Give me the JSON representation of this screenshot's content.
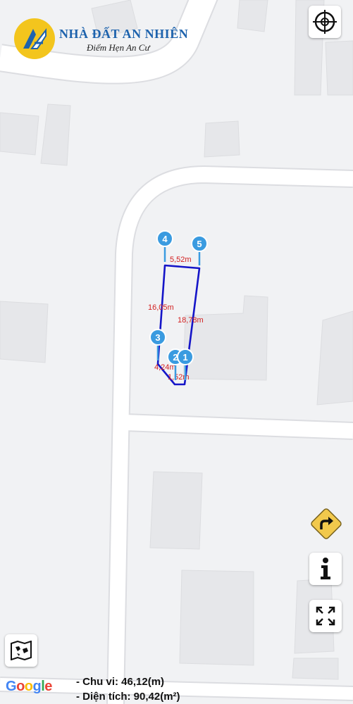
{
  "brand": {
    "name": "NHÀ ĐẤT AN NHIÊN",
    "tagline": "Điểm Hẹn An Cư"
  },
  "plot": {
    "vertices": [
      "1",
      "2",
      "3",
      "4",
      "5"
    ],
    "edge_lengths": [
      "5,52m",
      "16,05m",
      "18,78m",
      "4,24m",
      "1,52m"
    ],
    "outline_color": "#1515c8",
    "label_color": "#d21f1f",
    "pin_color": "#3a9be0"
  },
  "summary": {
    "perimeter": "- Chu vi: 46,12(m)",
    "area": "- Diện tích: 90,42(m²)"
  },
  "attribution": {
    "letters": [
      "G",
      "o",
      "o",
      "g",
      "l",
      "e"
    ],
    "colors": [
      "#4285f4",
      "#ea4335",
      "#fbbc05",
      "#4285f4",
      "#34a853",
      "#ea4335"
    ]
  },
  "controls": {
    "locate": "crosshair-icon",
    "directions": "turn-right-diamond-icon",
    "info": "info-icon",
    "fullscreen": "expand-icon",
    "map_layers": "map-icon"
  }
}
